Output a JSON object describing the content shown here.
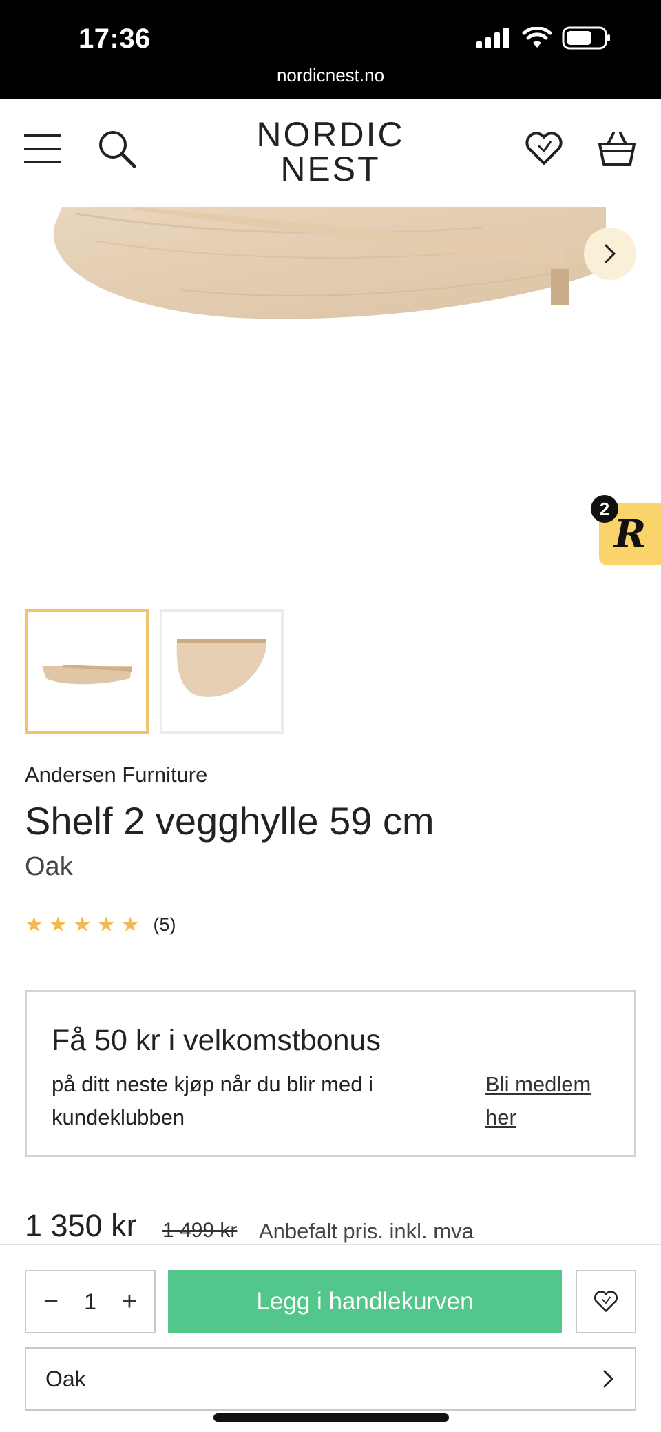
{
  "status_bar": {
    "time": "17:36",
    "url": "nordicnest.no"
  },
  "header": {
    "logo_line1": "NORDIC",
    "logo_line2": "NEST",
    "menu_icon": "menu-icon",
    "search_icon": "search-icon",
    "wishlist_icon": "heart-icon",
    "cart_icon": "basket-icon"
  },
  "gallery": {
    "next_icon": "chevron-right-icon",
    "reviews_badge_letter": "R",
    "reviews_badge_count": "2",
    "active_thumbnail_index": 0
  },
  "product": {
    "brand": "Andersen Furniture",
    "title": "Shelf 2 vegghylle 59 cm",
    "variant": "Oak",
    "rating_stars": 5,
    "rating_count": "(5)"
  },
  "bonus": {
    "heading": "Få 50 kr i velkomstbonus",
    "text": "på ditt neste kjøp når du blir med i kundeklubben",
    "link": "Bli medlem her"
  },
  "pricing": {
    "price": "1 350 kr",
    "old_price": "1 499 kr",
    "note": "Anbefalt pris. inkl. mva"
  },
  "purchase_bar": {
    "quantity": "1",
    "minus": "−",
    "plus": "+",
    "add_to_cart": "Legg i handlekurven",
    "selected_variant": "Oak"
  },
  "colors": {
    "accent_green": "#52c68b",
    "star_color": "#f2b94f",
    "active_thumb_border": "#f1c46b",
    "badge_yellow": "#fbd36b"
  }
}
